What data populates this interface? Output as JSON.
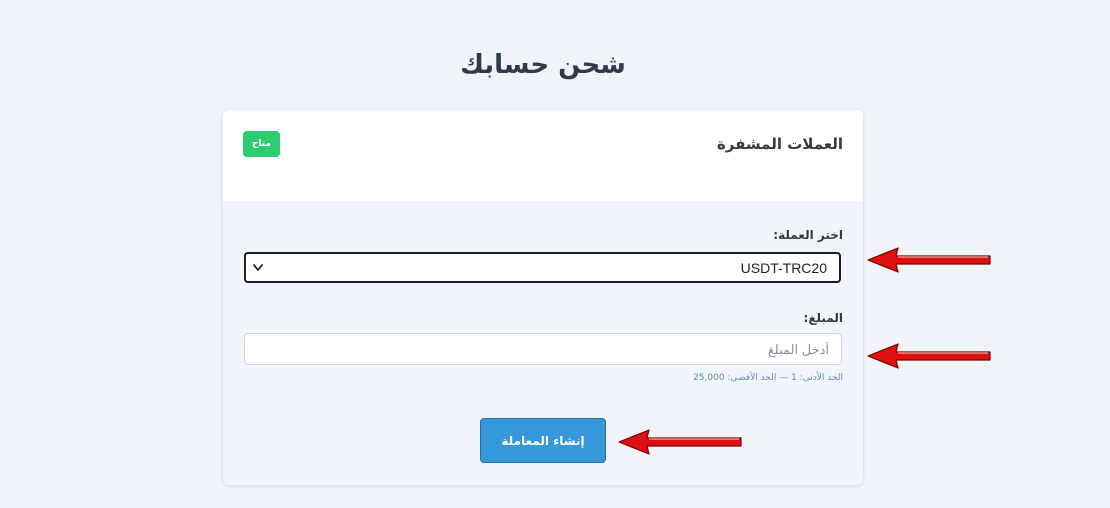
{
  "page": {
    "title": "شحن حسابك"
  },
  "card": {
    "header_title": "العملات المشفرة",
    "badge": "متاح",
    "currency_label": "اختر العملة:",
    "currency_selected": "USDT-TRC20",
    "amount_label": "المبلغ:",
    "amount_placeholder": "أدخل المبلغ",
    "amount_value": "",
    "hint": "الحد الأدنى: 1 — الحد الأقصى: 25,000",
    "submit_label": "إنشاء المعاملة"
  },
  "icons": {
    "select_chevron": "chevron-down-icon",
    "annotation_arrow": "arrow-left-icon"
  },
  "colors": {
    "background": "#f0f3f7",
    "badge": "#2ecc71",
    "primary_button": "#3498db",
    "hint_text": "#5a8fc8",
    "annotation_arrow": "#e01010"
  }
}
